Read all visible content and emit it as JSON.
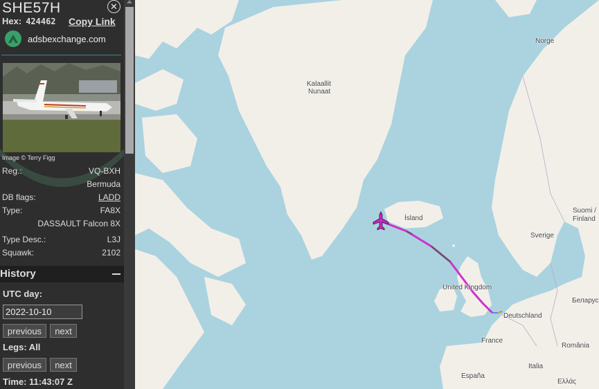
{
  "aircraft": {
    "callsign": "SHE57H",
    "hex_label": "Hex:",
    "hex": "424462",
    "copy_link": "Copy Link",
    "source": "adsbexchange.com",
    "photo_credit": "Image © Terry Figg"
  },
  "details": {
    "reg_label": "Reg.:",
    "reg": "VQ-BXH",
    "country": "Bermuda",
    "dbflags_label": "DB flags:",
    "dbflags": "LADD",
    "type_label": "Type:",
    "type": "FA8X",
    "model": "DASSAULT Falcon 8X",
    "typedesc_label": "Type Desc.:",
    "typedesc": "L3J",
    "squawk_label": "Squawk:",
    "squawk": "2102"
  },
  "history": {
    "title": "History",
    "utc_day_label": "UTC day:",
    "utc_day_value": "2022-10-10",
    "previous": "previous",
    "next": "next",
    "legs_label": "Legs: All",
    "time_label": "Time: 11:43:07 Z"
  },
  "map": {
    "labels": {
      "norge": "Norge",
      "greenland_1": "Kalaallit",
      "greenland_2": "Nunaat",
      "island": "Ísland",
      "suomi_1": "Suomi /",
      "suomi_2": "Finland",
      "sverige": "Sverige",
      "uk": "United Kingdom",
      "deutschland": "Deutschland",
      "belarus": "Беларус",
      "france": "France",
      "romania": "România",
      "italia": "Italia",
      "espana": "España",
      "ellas": "Ελλάς"
    },
    "colors": {
      "water": "#aad3df",
      "land": "#f2efe9",
      "track": "#cc33cc",
      "aircraft": "#cc22cc"
    }
  }
}
